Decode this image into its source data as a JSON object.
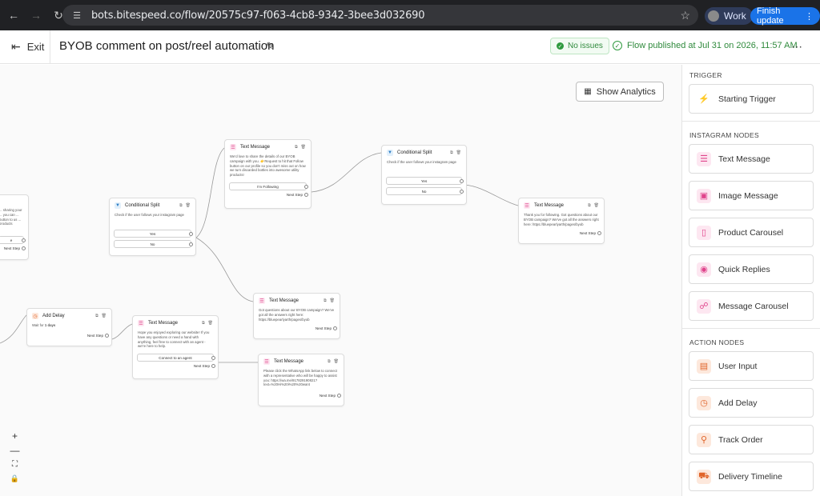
{
  "browser": {
    "url": "bots.bitespeed.co/flow/20575c97-f063-4cb8-9342-3bee3d032690",
    "profile_label": "Work",
    "finish_update_label": "Finish update"
  },
  "header": {
    "exit_label": "Exit",
    "flow_title": "BYOB comment on post/reel automation",
    "issues_badge": "No issues",
    "published_text": "Flow published at Jul 31 on 2026, 11:57 AM"
  },
  "canvas": {
    "show_analytics_label": "Show Analytics",
    "nodes": {
      "partial_left": {
        "body": "... sharing your ... you can ... button to us ... products",
        "option": "e",
        "next_step": "Next Step"
      },
      "split1": {
        "title": "Conditional Split",
        "body": "Check if the user follows your instagram page",
        "options": [
          "Yes",
          "No"
        ]
      },
      "msg_top": {
        "title": "Text Message",
        "body": "We'd love to share the details of our BYOB campaign with you. 👉Request to hit that Follow button on our profile so you don't miss out on how we turn discarded bottles into awesome utility products!",
        "button": "I'm Following",
        "next_step": "Next Step"
      },
      "split2": {
        "title": "Conditional Split",
        "body": "Check if the user follows your instagram page",
        "options": [
          "Yes",
          "No"
        ]
      },
      "msg_right": {
        "title": "Text Message",
        "body": "Thank you for following. Got questions about our BYOB campaign? We've got all the answers right here: https://bluepearlyarth/pages/byob",
        "next_step": "Next Step"
      },
      "msg_mid": {
        "title": "Text Message",
        "body": "Got questions about our BYOB campaign? We've got all the answers right here: https://bluepearlyarth/pages/byob",
        "next_step": "Next Step"
      },
      "delay": {
        "title": "Add Delay",
        "body_prefix": "Wait for",
        "body_value": "1 days",
        "next_step": "Next Step"
      },
      "msg_agent": {
        "title": "Text Message",
        "body": "Hope you enjoyed exploring our website! If you have any questions or need a hand with anything, feel free to connect with an agent - we're here to help.",
        "button": "Connect to an agent",
        "next_step": "Next Step"
      },
      "msg_whatsapp": {
        "title": "Text Message",
        "body": "Please click the WhatsApp link below to connect with a representative who will be happy to assist you: https://wa.me/917829190821?text=%20Hi%20i%20%20want",
        "next_step": "Next Step"
      }
    },
    "zoom": {
      "zoom_in": "+",
      "zoom_out": "—",
      "fit": "⛶",
      "lock": "🔒"
    }
  },
  "sidebar": {
    "trigger_title": "TRIGGER",
    "starting_trigger": "Starting Trigger",
    "instagram_title": "INSTAGRAM NODES",
    "instagram_items": [
      "Text Message",
      "Image Message",
      "Product Carousel",
      "Quick Replies",
      "Message Carousel"
    ],
    "action_title": "ACTION NODES",
    "action_items": [
      "User Input",
      "Add Delay",
      "Track Order",
      "Delivery Timeline"
    ]
  },
  "icons": {
    "back": "back-arrow-icon",
    "forward": "forward-arrow-icon",
    "reload": "reload-icon",
    "site": "site-settings-icon",
    "star": "bookmark-star-icon",
    "edit": "pencil-icon",
    "more": "more-dots-icon"
  }
}
